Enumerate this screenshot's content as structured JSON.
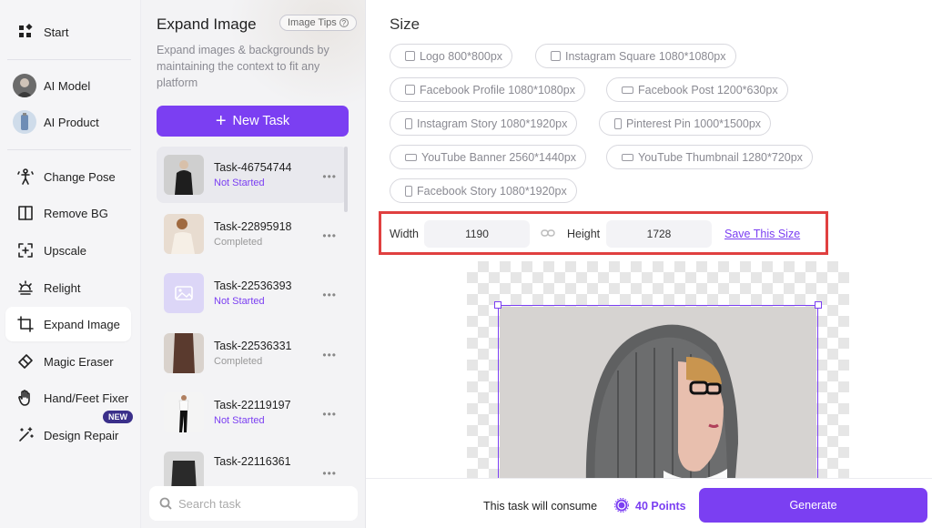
{
  "sidebar": {
    "start": "Start",
    "ai_model": "AI Model",
    "ai_product": "AI Product",
    "change_pose": "Change Pose",
    "remove_bg": "Remove BG",
    "upscale": "Upscale",
    "relight": "Relight",
    "expand_image": "Expand Image",
    "magic_eraser": "Magic Eraser",
    "hand_feet_fixer": "Hand/Feet Fixer",
    "design_repair": "Design Repair",
    "new_badge": "NEW",
    "active_item": "Expand Image"
  },
  "task_panel": {
    "title": "Expand Image",
    "tips_label": "Image Tips",
    "description": "Expand images & backgrounds by maintaining the context to fit any platform",
    "new_task_label": "New Task",
    "tasks": [
      {
        "name": "Task-46754744",
        "status": "Not Started"
      },
      {
        "name": "Task-22895918",
        "status": "Completed"
      },
      {
        "name": "Task-22536393",
        "status": "Not Started"
      },
      {
        "name": "Task-22536331",
        "status": "Completed"
      },
      {
        "name": "Task-22119197",
        "status": "Not Started"
      },
      {
        "name": "Task-22116361",
        "status": ""
      }
    ],
    "search_placeholder": "Search task"
  },
  "main": {
    "size_title": "Size",
    "presets": [
      "Logo 800*800px",
      "Instagram Square 1080*1080px",
      "Facebook Profile 1080*1080px",
      "Facebook Post 1200*630px",
      "Instagram Story 1080*1920px",
      "Pinterest Pin 1000*1500px",
      "YouTube Banner 2560*1440px",
      "YouTube Thumbnail 1280*720px",
      "Facebook Story 1080*1920px"
    ],
    "width_label": "Width",
    "width_value": "1190",
    "height_label": "Height",
    "height_value": "1728",
    "save_size_label": "Save This Size",
    "consume_text": "This task will consume",
    "points": "40 Points",
    "generate_label": "Generate"
  },
  "colors": {
    "accent": "#7b3ff2",
    "highlight_box": "#e04040"
  }
}
